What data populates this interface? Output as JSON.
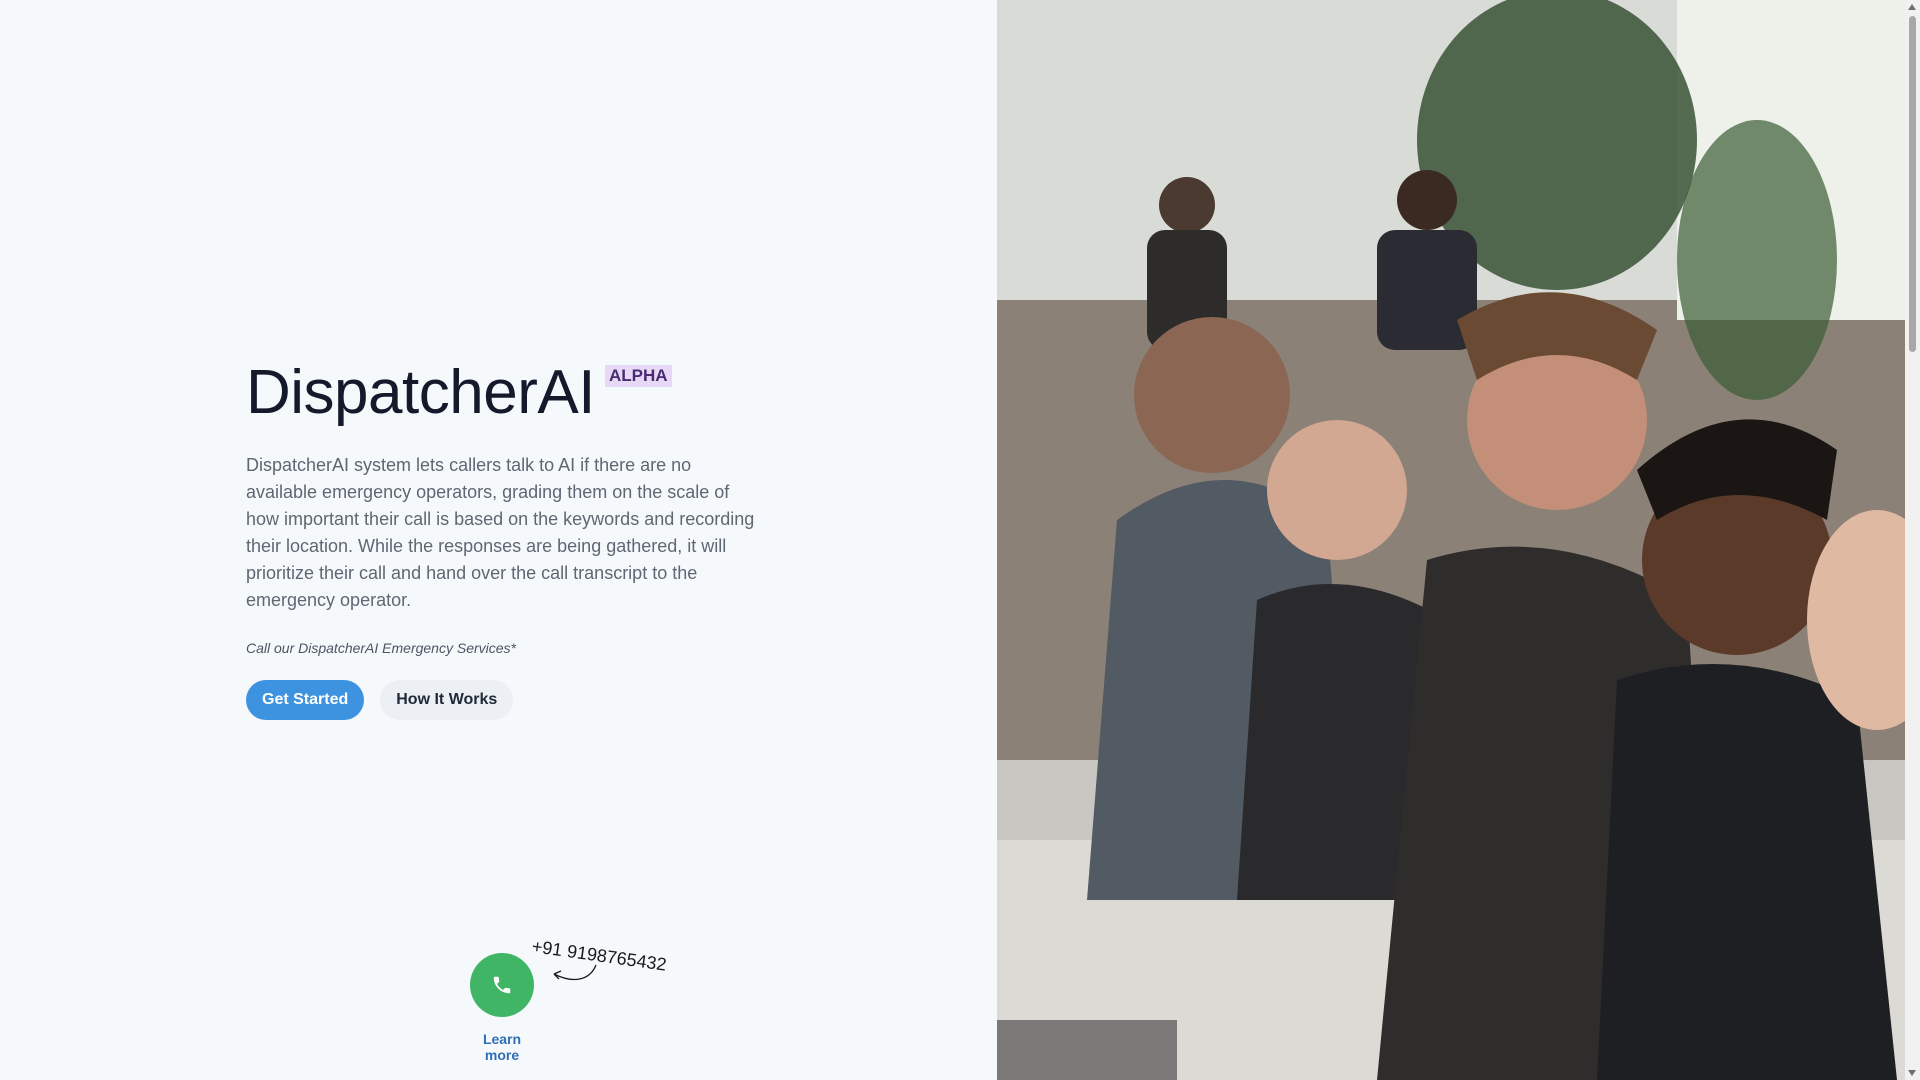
{
  "hero": {
    "title": "DispatcherAI",
    "badge": "ALPHA",
    "description": "DispatcherAI system lets callers talk to AI if there are no available emergency operators, grading them on the scale of how important their call is based on the keywords and recording their location. While the responses are being gathered, it will prioritize their call and hand over the call transcript to the emergency operator.",
    "call_note": "Call our DispatcherAI Emergency Services*",
    "buttons": {
      "get_started": "Get Started",
      "how_it_works": "How It Works"
    }
  },
  "call_widget": {
    "icon": "phone-icon",
    "phone_number": "+91 9198765432",
    "learn_more": "Learn more"
  },
  "colors": {
    "primary_button": "#3d93e0",
    "call_button": "#3fb565",
    "badge_bg": "#e7d9f5",
    "link": "#2f6fb4"
  }
}
